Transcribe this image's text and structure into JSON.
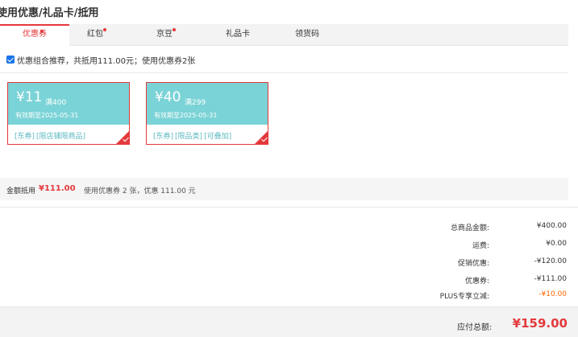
{
  "header": {
    "title": "使用优惠/礼品卡/抵用"
  },
  "tabs": [
    {
      "label": "优惠券",
      "active": true,
      "dot": true
    },
    {
      "label": "红包",
      "active": false,
      "dot": true
    },
    {
      "label": "京豆",
      "active": false,
      "dot": true
    },
    {
      "label": "礼品卡",
      "active": false,
      "dot": false
    },
    {
      "label": "领货码",
      "active": false,
      "dot": false
    }
  ],
  "recommend": {
    "checked": true,
    "text": "优惠组合推荐，共抵用111.00元；使用优惠券2张"
  },
  "coupons": [
    {
      "amount": "¥11",
      "condition": "满400",
      "expire": "有效期至2025-05-31",
      "tags": [
        "[东券]",
        "[限店铺限商品]"
      ],
      "selected": true
    },
    {
      "amount": "¥40",
      "condition": "满299",
      "expire": "有效期至2025-05-31",
      "tags": [
        "[东券]",
        "[限品类]",
        "[可叠加]"
      ],
      "selected": true
    }
  ],
  "summary": {
    "label": "金额抵用",
    "amount": "¥111.00",
    "desc": "使用优惠券 2 张，优惠 111.00 元"
  },
  "price_rows": [
    {
      "label": "总商品金额:",
      "value": "¥400.00"
    },
    {
      "label": "运费:",
      "value": "¥0.00"
    },
    {
      "label": "促销优惠:",
      "value": "-¥120.00"
    },
    {
      "label": "优惠券:",
      "value": "-¥111.00"
    },
    {
      "label": "PLUS专享立减:",
      "value": "-¥10.00"
    }
  ],
  "total": {
    "label": "应付总额:",
    "value": "¥159.00"
  },
  "colors": {
    "accent": "#e4393c",
    "coupon_bg": "#7ad3d6",
    "plus_orange": "#ff6600",
    "tag_teal": "#5bb8c0"
  },
  "icons": {
    "collapse": "chevron-up-icon",
    "checkbox": "checkbox-checked-icon",
    "coupon_selected": "check-corner-icon"
  }
}
